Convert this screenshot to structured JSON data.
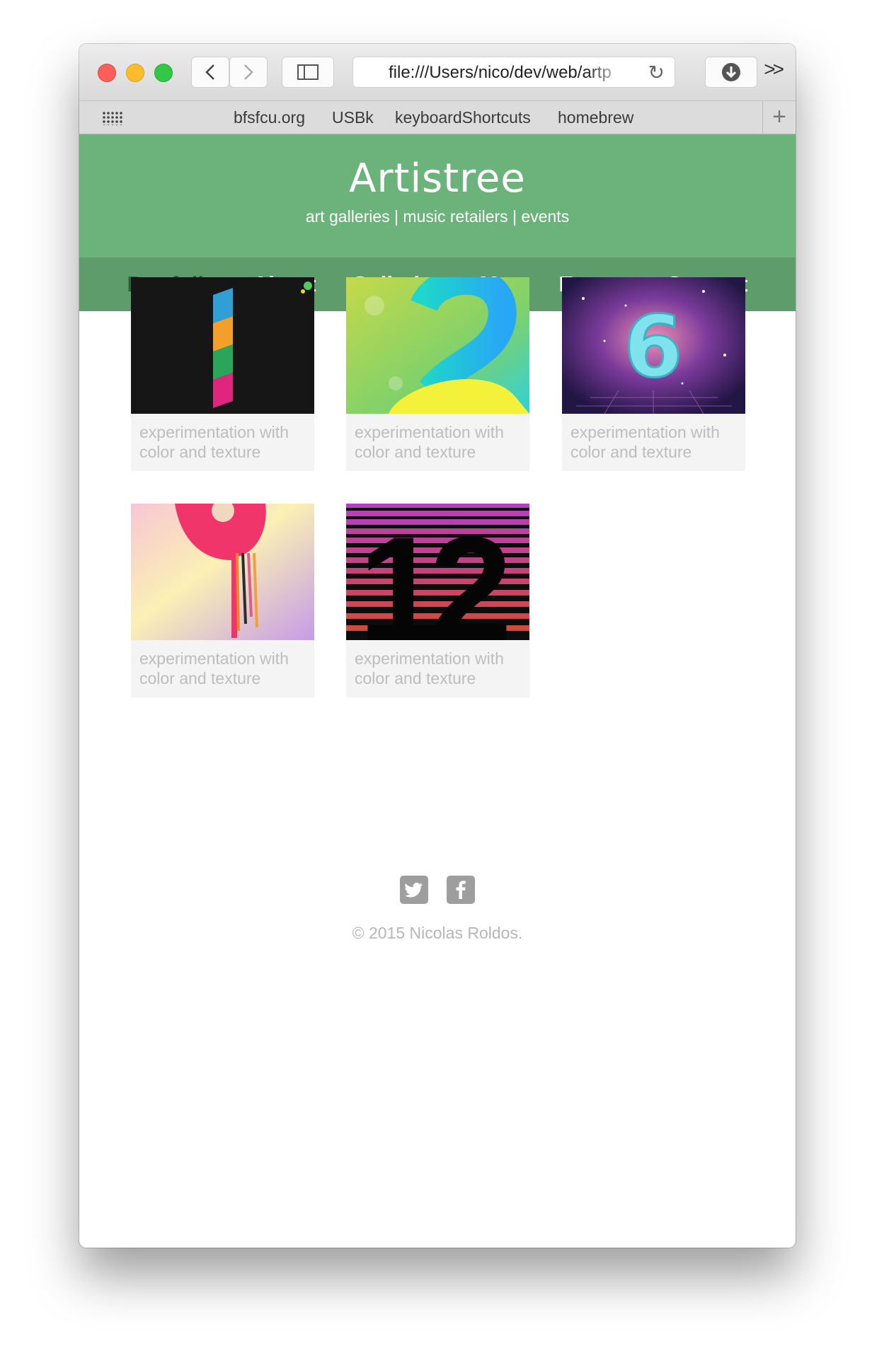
{
  "browser": {
    "url": "file:///Users/nico/dev/web/artp",
    "bookmarks": [
      "bfsfcu.org",
      "USBk",
      "keyboardShortcuts",
      "homebrew"
    ]
  },
  "site": {
    "title": "Artistree",
    "tagline": "art galleries | music retailers | events",
    "nav": [
      "Portfolio",
      "About",
      "Galleries",
      "Map",
      "Events",
      "Contact"
    ],
    "active_nav": "Portfolio"
  },
  "gallery": {
    "items": [
      {
        "caption": "experimentation with color and texture",
        "artwork": "number-1"
      },
      {
        "caption": "experimentation with color and texture",
        "artwork": "number-2"
      },
      {
        "caption": "experimentation with color and texture",
        "artwork": "number-6"
      },
      {
        "caption": "experimentation with color and texture",
        "artwork": "number-9"
      },
      {
        "caption": "experimentation with color and texture",
        "artwork": "number-12"
      }
    ]
  },
  "footer": {
    "copyright": "© 2015 Nicolas Roldos.",
    "social": [
      "twitter-icon",
      "facebook-icon"
    ]
  },
  "colors": {
    "header": "#6bb37b",
    "nav": "#5f9c6c",
    "active_nav": "#2f5f39"
  }
}
